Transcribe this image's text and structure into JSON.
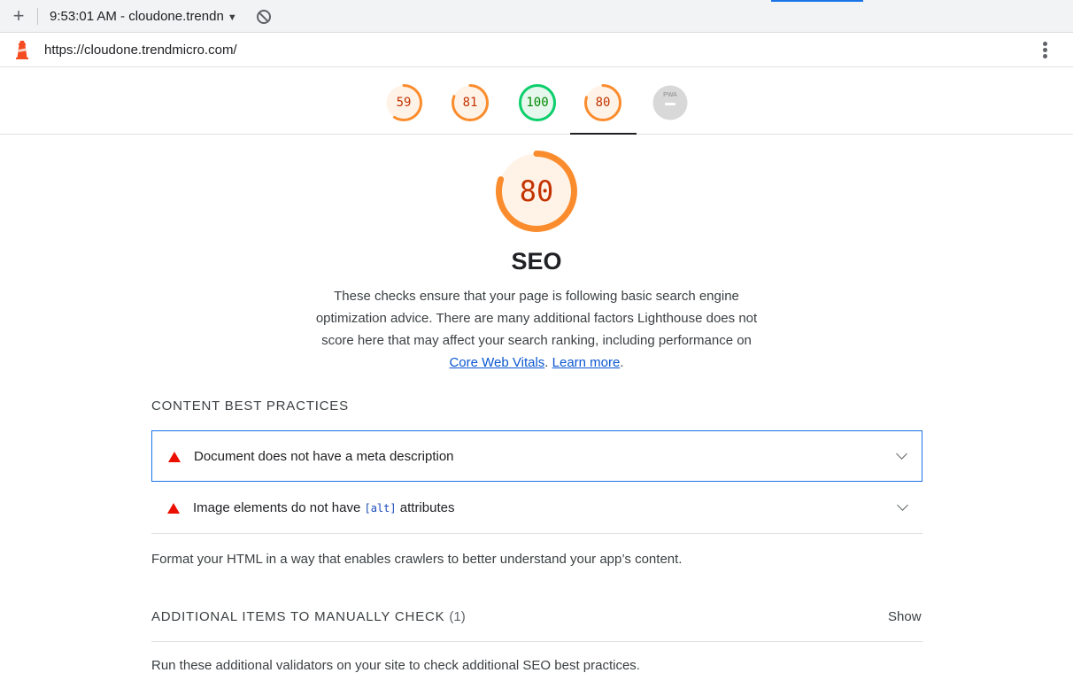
{
  "toolbar": {
    "new_icon": "plus-icon",
    "report_label": "9:53:01 AM - cloudone.trendn",
    "dropdown_icon": "caret-down-icon",
    "clear_icon": "block-icon"
  },
  "urlbar": {
    "logo_icon": "lighthouse-icon",
    "url": "https://cloudone.trendmicro.com/",
    "menu_icon": "kebab-menu-icon"
  },
  "gauges": [
    {
      "label": "59",
      "score": 0.59,
      "color": "#c33300",
      "ring": "#fa8c2d",
      "fill": "#fff3e8"
    },
    {
      "label": "81",
      "score": 0.81,
      "color": "#c33300",
      "ring": "#fa8c2d",
      "fill": "#fff3e8"
    },
    {
      "label": "100",
      "score": 1.0,
      "color": "#008800",
      "ring": "#0cce6b",
      "fill": "#e6f7ed"
    },
    {
      "label": "80",
      "score": 0.8,
      "color": "#c33300",
      "ring": "#fa8c2d",
      "fill": "#fff3e8"
    },
    {
      "label": "PWA",
      "score": 0,
      "color": "#9e9e9e",
      "ring": "#d8d8d8",
      "fill": "#d8d8d8"
    }
  ],
  "category": {
    "score": "80",
    "score_fraction": 0.8,
    "title": "SEO",
    "description": "These checks ensure that your page is following basic search engine optimization advice. There are many additional factors Lighthouse does not score here that may affect your search ranking, including performance on",
    "link_cwv": "Core Web Vitals",
    "sep": ".",
    "link_learn": "Learn more",
    "end": "."
  },
  "content_group": {
    "title": "Content Best Practices",
    "audits": [
      {
        "title": "Document does not have a meta description"
      },
      {
        "title_before": "Image elements do not have ",
        "code": "[alt]",
        "title_after": " attributes"
      }
    ],
    "description": "Format your HTML in a way that enables crawlers to better understand your app’s content."
  },
  "manual_group": {
    "title": "Additional items to manually check",
    "count": "(1)",
    "toggle": "Show",
    "description": "Run these additional validators on your site to check additional SEO best practices."
  }
}
